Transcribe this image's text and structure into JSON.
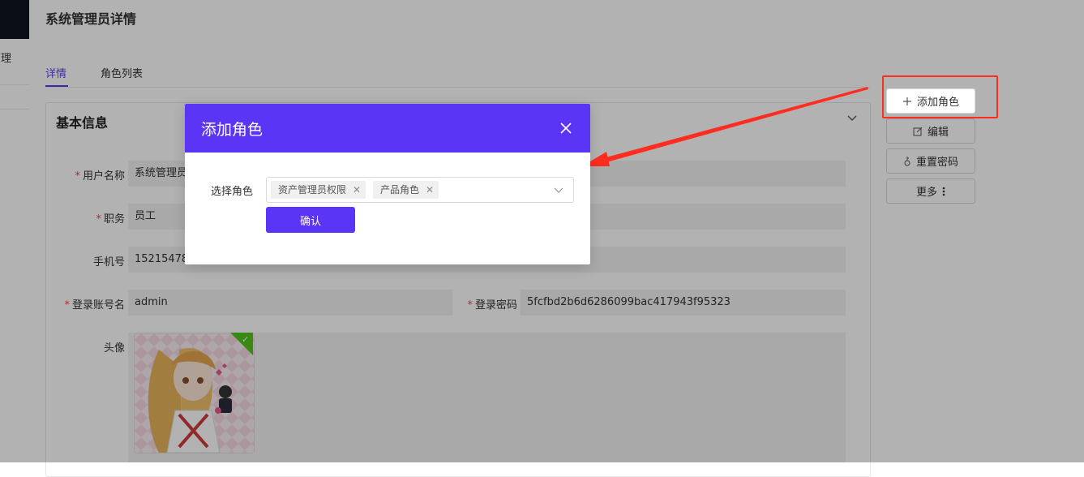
{
  "header": {
    "title": "系统管理员详情"
  },
  "nav": {
    "partial_item": "管理"
  },
  "tabs": [
    {
      "label": "详情",
      "active": true
    },
    {
      "label": "角色列表",
      "active": false
    }
  ],
  "card": {
    "title": "基本信息",
    "fields": {
      "username": {
        "label": "用户名称",
        "required": true,
        "value": "系统管理员"
      },
      "position": {
        "label": "职务",
        "required": true,
        "value": "员工"
      },
      "phone": {
        "label": "手机号",
        "required": false,
        "value": "15215478"
      },
      "account": {
        "label": "登录账号名",
        "required": true,
        "value": "admin"
      },
      "password": {
        "label": "登录密码",
        "required": true,
        "value": "5fcfbd2b6d6286099bac417943f95323"
      },
      "avatar": {
        "label": "头像"
      }
    }
  },
  "actions": {
    "add_role": "添加角色",
    "edit": "编辑",
    "reset_password": "重置密码",
    "more": "更多"
  },
  "modal": {
    "title": "添加角色",
    "select_label": "选择角色",
    "selected_roles": [
      "资产管理员权限",
      "产品角色"
    ],
    "confirm": "确认"
  },
  "colors": {
    "brand": "#5b35f5",
    "annotation": "#ff2d1f",
    "required": "#f04a3e"
  },
  "icons": [
    "close-icon",
    "chevron-down-icon",
    "plus-icon",
    "edit-icon",
    "key-icon",
    "more-vertical-icon",
    "check-icon"
  ]
}
